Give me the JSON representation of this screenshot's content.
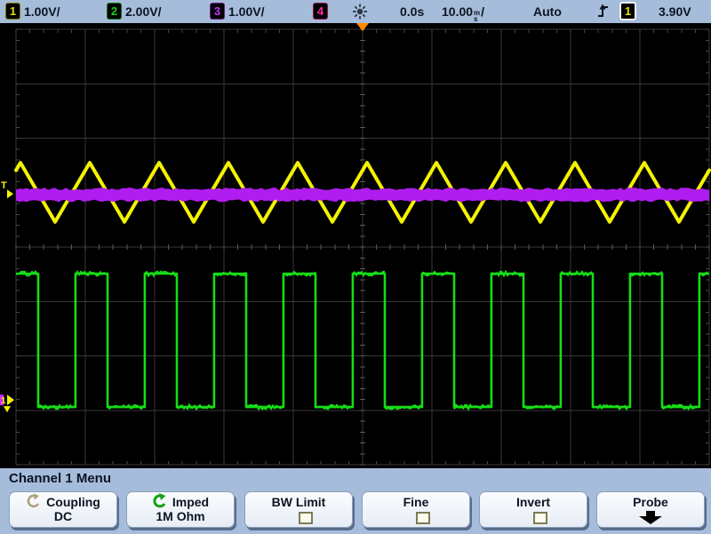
{
  "topbar": {
    "channels": [
      {
        "id": "1",
        "scale": "1.00V/",
        "color": "#e3df00"
      },
      {
        "id": "2",
        "scale": "2.00V/",
        "color": "#17d417"
      },
      {
        "id": "3",
        "scale": "1.00V/",
        "color": "#c936ff"
      },
      {
        "id": "4",
        "scale": "",
        "color": "#ff2f9f"
      }
    ],
    "time_offset": "0.0s",
    "timebase_value": "10.00",
    "timebase_unit_top": "m",
    "timebase_unit_bottom": "s",
    "timebase_suffix": "/",
    "trigger_mode": "Auto",
    "trigger_source": "1",
    "trigger_level": "3.90V"
  },
  "menu_title": "Channel 1 Menu",
  "softkeys": [
    {
      "line1": "Coupling",
      "line2": "DC",
      "control": "knob"
    },
    {
      "line1": "Imped",
      "line2": "1M Ohm",
      "control": "knob-active"
    },
    {
      "line1": "BW Limit",
      "line2": "",
      "control": "checkbox"
    },
    {
      "line1": "Fine",
      "line2": "",
      "control": "checkbox"
    },
    {
      "line1": "Invert",
      "line2": "",
      "control": "checkbox"
    },
    {
      "line1": "Probe",
      "line2": "",
      "control": "menu-arrow"
    }
  ],
  "ui_colors": {
    "chrome_bg": "#a5bcda",
    "screen_bg": "#000000",
    "grid": "#383838"
  },
  "chart_data": {
    "type": "line",
    "title": "Oscilloscope waveform display",
    "grid": {
      "x_divs": 10,
      "y_divs": 8,
      "timebase_per_div": "10.00ms",
      "time_offset": "0.0s",
      "trigger_mode": "Auto"
    },
    "series": [
      {
        "name": "channel-1-triangle",
        "color": "#f4f400",
        "shape": "triangle",
        "volts_per_div": "1.00V",
        "period_divs": 1.0,
        "first_peak_div_x": 0.064,
        "peak_div_y": 2.45,
        "trough_div_y": 3.54,
        "approx_high_v": 4.36,
        "approx_low_v": 3.27
      },
      {
        "name": "channel-3-noise-band",
        "color": "#b01df0",
        "shape": "noise_band",
        "volts_per_div": "1.00V",
        "center_div_y": 3.04,
        "half_width_div": 0.11,
        "approx_level_v": 3.77
      },
      {
        "name": "channel-2-square",
        "color": "#16dd16",
        "shape": "square",
        "volts_per_div": "2.00V",
        "period_divs": 1.0,
        "first_fall_div_x": 0.32,
        "low_frac": 0.538,
        "high_div_y": 4.49,
        "low_div_y": 6.94,
        "approx_amplitude_v": 4.9
      }
    ],
    "markers": {
      "trigger_time_div_x": 5.0,
      "trigger_level_div_y": 2.91,
      "ch1_ground_div_y": 6.81,
      "trigger_marker_color": "#ff8a00",
      "trigger_level_color": "#f4f400"
    }
  }
}
